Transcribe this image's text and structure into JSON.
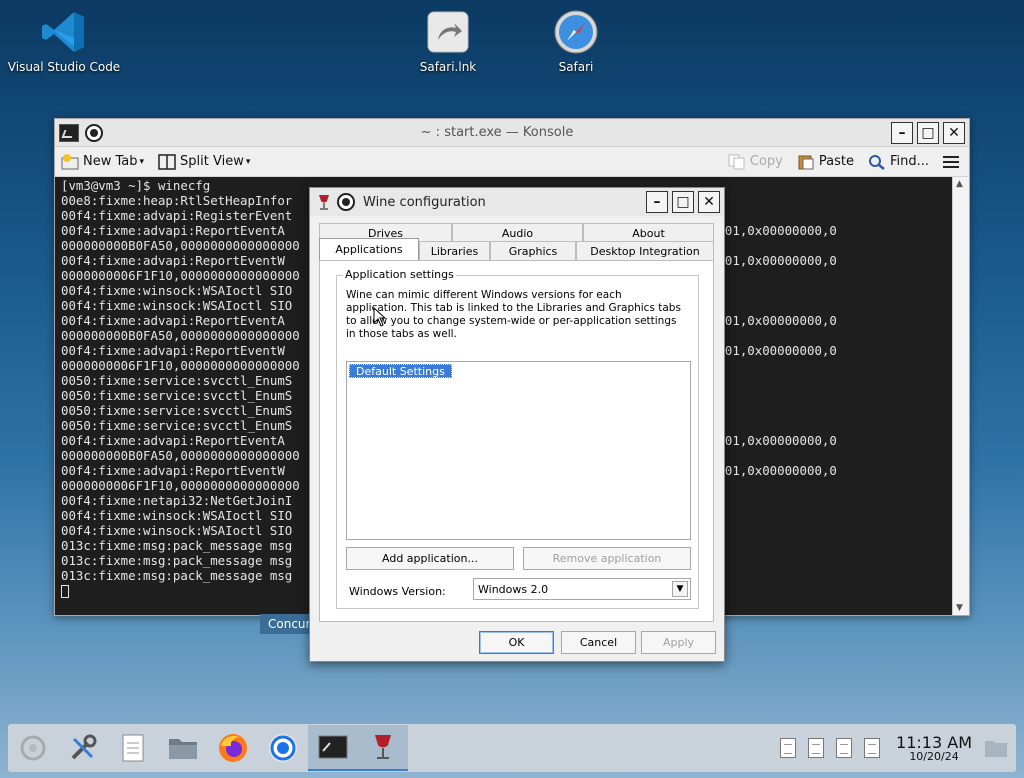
{
  "desktop": {
    "icons": [
      {
        "label": "Visual Studio Code",
        "icon": "vscode-icon"
      },
      {
        "label": "Safari.lnk",
        "icon": "shortcut-icon"
      },
      {
        "label": "Safari",
        "icon": "safari-compass-icon"
      }
    ]
  },
  "konsole": {
    "title": "~ : start.exe — Konsole",
    "toolbar": {
      "new_tab": "New Tab",
      "split_view": "Split View",
      "copy": "Copy",
      "paste": "Paste",
      "find": "Find..."
    },
    "lines": [
      "[vm3@vm3 ~]$ winecfg",
      "00e8:fixme:heap:RtlSetHeapInfor",
      "00f4:fixme:advapi:RegisterEvent",
      "00f4:fixme:advapi:ReportEventA                                               0000000,0x0001,0x00000000,0",
      "000000000B0FA50,0000000000000000                                             ",
      "00f4:fixme:advapi:ReportEventW                                               0000000,0x0001,0x00000000,0",
      "0000000006F1F10,0000000000000000",
      "00f4:fixme:winsock:WSAIoctl SIO",
      "00f4:fixme:winsock:WSAIoctl SIO",
      "00f4:fixme:advapi:ReportEventA                                               0000000,0x0001,0x00000000,0",
      "000000000B0FA50,0000000000000000",
      "00f4:fixme:advapi:ReportEventW                                               0000000,0x0001,0x00000000,0",
      "0000000006F1F10,0000000000000000",
      "0050:fixme:service:svcctl_EnumS",
      "0050:fixme:service:svcctl_EnumS",
      "0050:fixme:service:svcctl_EnumS",
      "0050:fixme:service:svcctl_EnumS",
      "00f4:fixme:advapi:ReportEventA                                               0000000,0x0001,0x00000000,0",
      "000000000B0FA50,0000000000000000",
      "00f4:fixme:advapi:ReportEventW                                               0000000,0x0001,0x00000000,0",
      "0000000006F1F10,0000000000000000",
      "00f4:fixme:netapi32:NetGetJoinI                                              000B0FAC0",
      "00f4:fixme:winsock:WSAIoctl SIO",
      "00f4:fixme:winsock:WSAIoctl SIO",
      "013c:fixme:msg:pack_message msg",
      "013c:fixme:msg:pack_message msg",
      "013c:fixme:msg:pack_message msg"
    ],
    "behind_label": "Concur"
  },
  "wine_dialog": {
    "title": "Wine configuration",
    "tabs_top": [
      "Drives",
      "Audio",
      "About"
    ],
    "tabs_bottom": [
      "Applications",
      "Libraries",
      "Graphics",
      "Desktop Integration"
    ],
    "active_tab": "Applications",
    "group_title": "Application settings",
    "description": "Wine can mimic different Windows versions for each application. This tab is linked to the Libraries and Graphics tabs to allow you to change system-wide or per-application settings in those tabs as well.",
    "applications": [
      "Default Settings"
    ],
    "add_button": "Add application...",
    "remove_button": "Remove application",
    "windows_version_label": "Windows Version:",
    "windows_version_value": "Windows 2.0",
    "ok": "OK",
    "cancel": "Cancel",
    "apply": "Apply"
  },
  "taskbar": {
    "apps": [
      "launcher-icon",
      "system-settings-icon",
      "text-editor-icon",
      "file-manager-icon",
      "firefox-icon",
      "chrome-icon",
      "konsole-icon",
      "wine-icon"
    ],
    "clock_time": "11:13 AM",
    "clock_date": "10/20/24"
  },
  "colors": {
    "accent": "#3a7bd5",
    "terminal_bg": "#1e1e1e"
  }
}
